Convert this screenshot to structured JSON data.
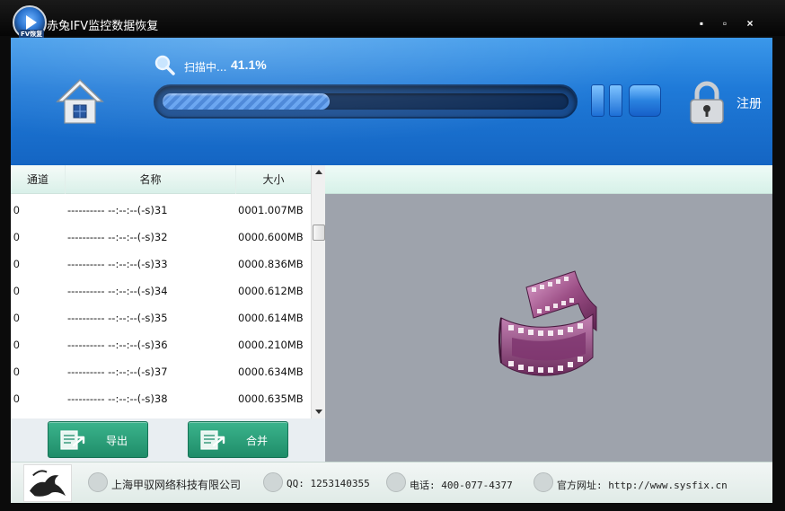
{
  "window": {
    "title": "赤兔IFV监控数据恢复",
    "logo_tag": "FV恢复",
    "minimize": "▪",
    "maximize": "▫",
    "close": "×"
  },
  "scan": {
    "label": "扫描中...",
    "percent_text": "41.1%",
    "progress": 0.411
  },
  "header": {
    "register_label": "注册"
  },
  "table": {
    "columns": [
      "通道",
      "名称",
      "大小"
    ],
    "rows": [
      {
        "channel": "0",
        "name": "---------- --:--:--(-s)31",
        "size": "0001.007MB"
      },
      {
        "channel": "0",
        "name": "---------- --:--:--(-s)32",
        "size": "0000.600MB"
      },
      {
        "channel": "0",
        "name": "---------- --:--:--(-s)33",
        "size": "0000.836MB"
      },
      {
        "channel": "0",
        "name": "---------- --:--:--(-s)34",
        "size": "0000.612MB"
      },
      {
        "channel": "0",
        "name": "---------- --:--:--(-s)35",
        "size": "0000.614MB"
      },
      {
        "channel": "0",
        "name": "---------- --:--:--(-s)36",
        "size": "0000.210MB"
      },
      {
        "channel": "0",
        "name": "---------- --:--:--(-s)37",
        "size": "0000.634MB"
      },
      {
        "channel": "0",
        "name": "---------- --:--:--(-s)38",
        "size": "0000.635MB"
      }
    ]
  },
  "actions": {
    "export_label": "导出",
    "merge_label": "合并"
  },
  "footer": {
    "company": "上海甲驭网络科技有限公司",
    "qq": "QQ: 1253140355",
    "phone": "电话: 400-077-4377",
    "website": "官方网址: http://www.sysfix.cn"
  },
  "colors": {
    "header_blue": "#1f7ad8",
    "button_green": "#2a9f7a",
    "film_purple": "#9c4f86"
  }
}
